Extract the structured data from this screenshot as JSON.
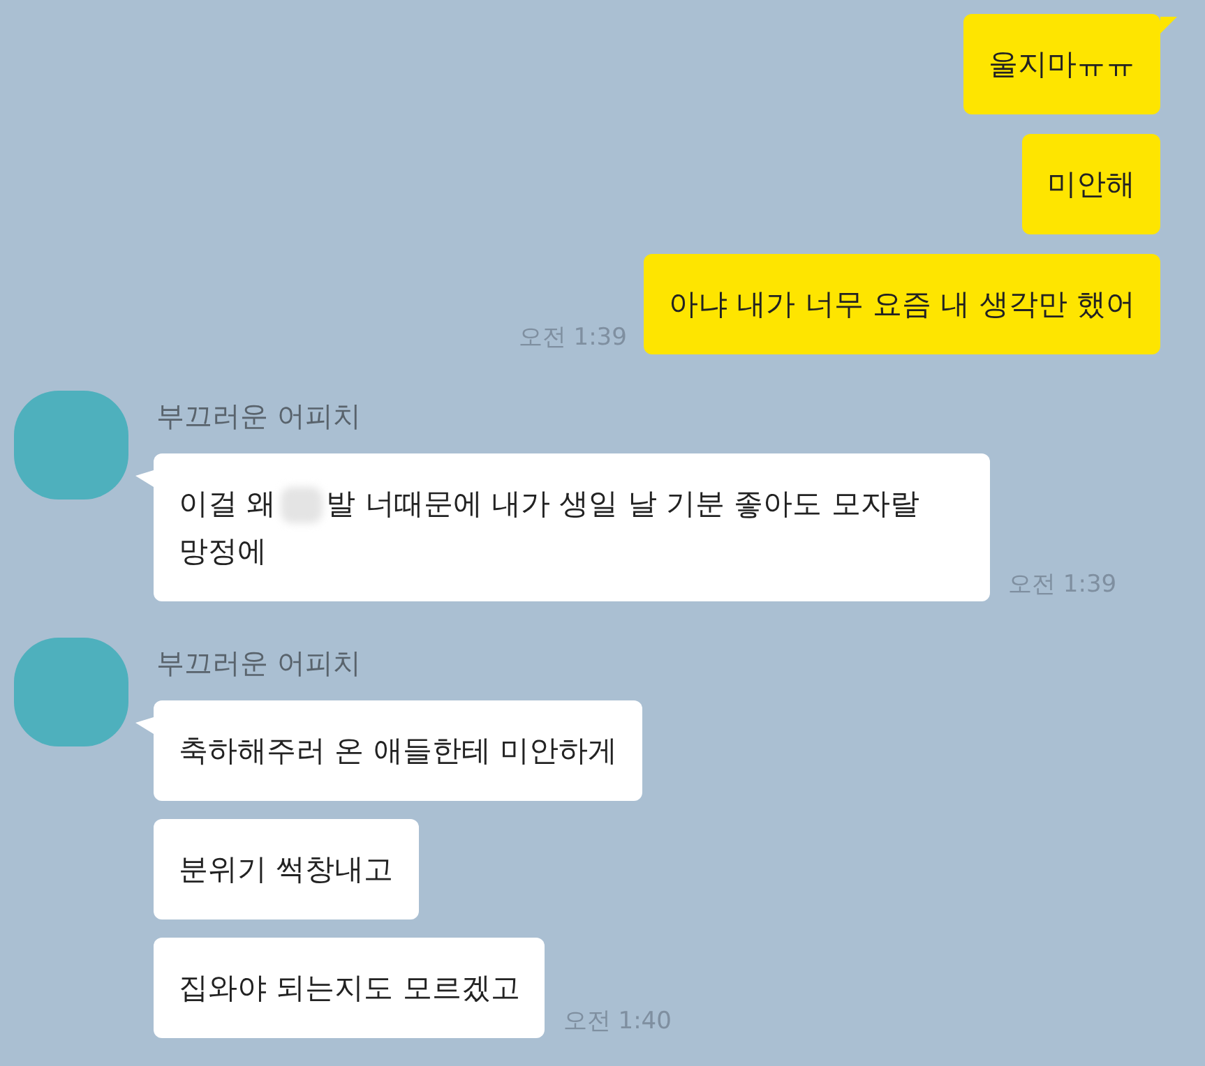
{
  "messages": [
    {
      "kind": "sent",
      "bubbles": [
        {
          "text": "울지마ㅠㅠ"
        },
        {
          "text": "미안해"
        },
        {
          "text": "아냐 내가 너무 요즘 내 생각만 했어"
        }
      ],
      "time": "오전 1:39"
    },
    {
      "kind": "received",
      "sender": "부끄러운 어피치",
      "bubbles": [
        {
          "parts": [
            {
              "kind": "text",
              "text": "이걸 왜"
            },
            {
              "kind": "blur"
            },
            {
              "kind": "text",
              "text": "발 너때문에 내가 생일 날 기분 좋아도 모자랄 망정에"
            }
          ]
        }
      ],
      "time": "오전 1:39"
    },
    {
      "kind": "received",
      "sender": "부끄러운 어피치",
      "bubbles": [
        {
          "text": "축하해주러 온 애들한테 미안하게"
        },
        {
          "text": "분위기 썩창내고"
        },
        {
          "text": "집와야 되는지도 모르겠고"
        }
      ],
      "time": "오전 1:40"
    }
  ]
}
